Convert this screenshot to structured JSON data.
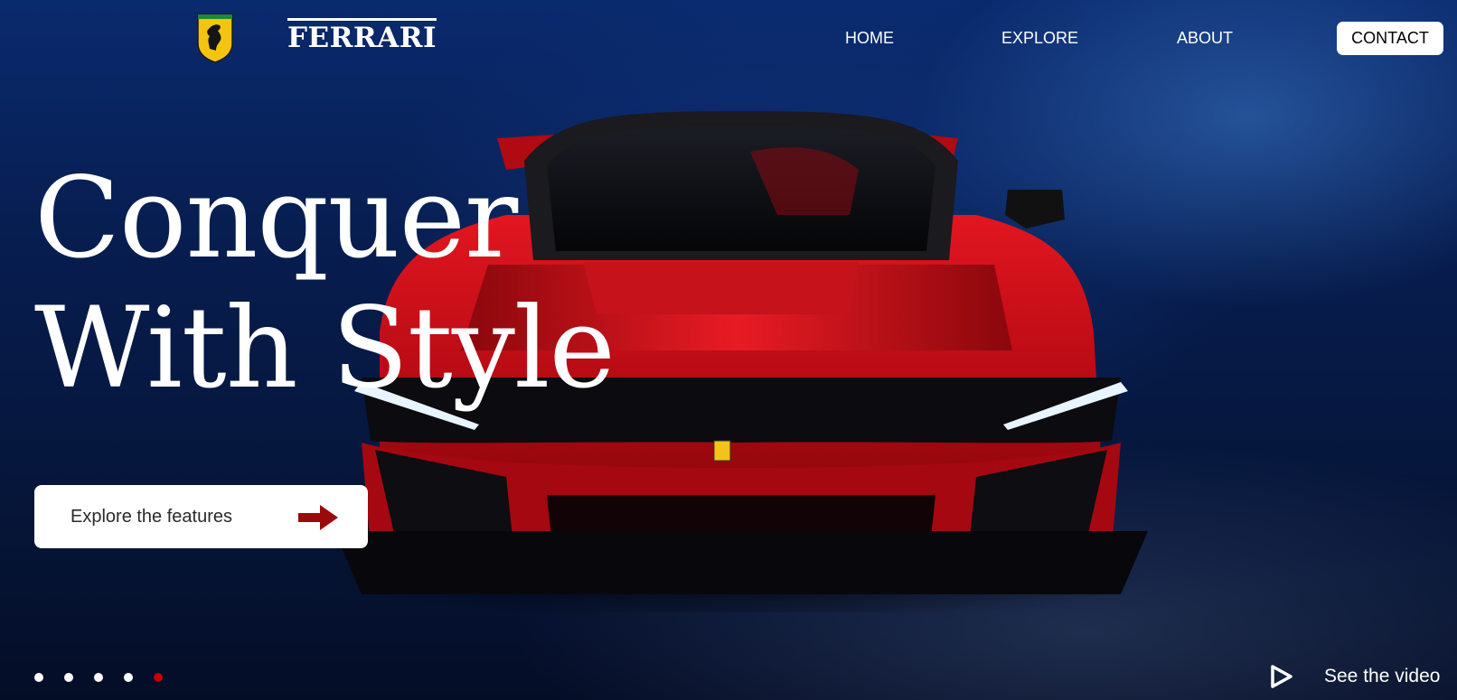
{
  "brand": {
    "name": "FERRARI",
    "logo": "prancing-horse-shield-logo"
  },
  "nav": {
    "items": [
      {
        "label": "HOME"
      },
      {
        "label": "EXPLORE"
      },
      {
        "label": "ABOUT"
      }
    ],
    "contact_label": "CONTACT"
  },
  "hero": {
    "headline_line1": "Conquer",
    "headline_line2": "With Style",
    "cta_label": "Explore the features",
    "cta_icon": "arrow-right-icon"
  },
  "carousel": {
    "slide_count": 5,
    "active_index": 4
  },
  "video": {
    "label": "See the video",
    "icon": "play-icon"
  },
  "colors": {
    "accent": "#9b0a0a",
    "active_dot": "#c40000",
    "background": "#071d4f",
    "car_red": "#d0101a"
  }
}
